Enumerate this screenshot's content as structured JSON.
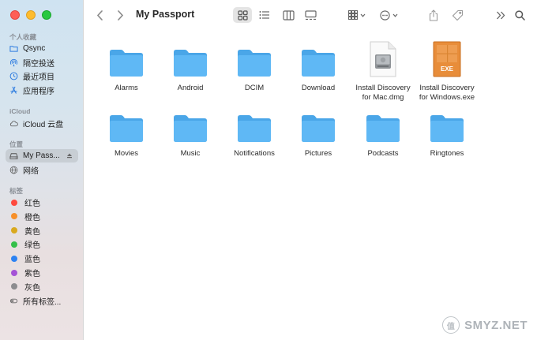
{
  "window": {
    "title": "My Passport"
  },
  "sidebar": {
    "sections": {
      "favorites": "个人收藏",
      "icloud": "iCloud",
      "locations": "位置",
      "tags": "标签"
    },
    "favorites": [
      {
        "label": "Qsync",
        "icon": "folder-icon"
      },
      {
        "label": "隔空投送",
        "icon": "airdrop-icon"
      },
      {
        "label": "最近项目",
        "icon": "clock-icon"
      },
      {
        "label": "应用程序",
        "icon": "applications-icon"
      }
    ],
    "icloud": [
      {
        "label": "iCloud 云盘",
        "icon": "cloud-icon"
      }
    ],
    "locations": [
      {
        "label": "My Pass...",
        "icon": "drive-icon",
        "selected": true
      },
      {
        "label": "网络",
        "icon": "globe-icon"
      }
    ],
    "tags": [
      {
        "label": "红色",
        "color": "#ff4a3f"
      },
      {
        "label": "橙色",
        "color": "#f7902a"
      },
      {
        "label": "黄色",
        "color": "#d9a91e"
      },
      {
        "label": "绿色",
        "color": "#34c04a"
      },
      {
        "label": "蓝色",
        "color": "#2d82f2"
      },
      {
        "label": "紫色",
        "color": "#a453d6"
      },
      {
        "label": "灰色",
        "color": "#8c8c8f"
      },
      {
        "label": "所有标签...",
        "icon": "tags-icon"
      }
    ]
  },
  "files": [
    {
      "name": "Alarms",
      "kind": "folder"
    },
    {
      "name": "Android",
      "kind": "folder"
    },
    {
      "name": "DCIM",
      "kind": "folder"
    },
    {
      "name": "Download",
      "kind": "folder"
    },
    {
      "name": "Install Discovery\nfor Mac.dmg",
      "kind": "dmg"
    },
    {
      "name": "Install Discovery\nfor Windows.exe",
      "kind": "exe",
      "badge": "EXE"
    },
    {
      "name": "Movies",
      "kind": "folder"
    },
    {
      "name": "Music",
      "kind": "folder"
    },
    {
      "name": "Notifications",
      "kind": "folder"
    },
    {
      "name": "Pictures",
      "kind": "folder"
    },
    {
      "name": "Podcasts",
      "kind": "folder"
    },
    {
      "name": "Ringtones",
      "kind": "folder"
    }
  ],
  "watermark": "SMYZ.NET",
  "watermark_mark": "值",
  "colors": {
    "folder_front": "#5fb8f5",
    "folder_back": "#4aa6e8",
    "accent": "#2f7de0"
  }
}
